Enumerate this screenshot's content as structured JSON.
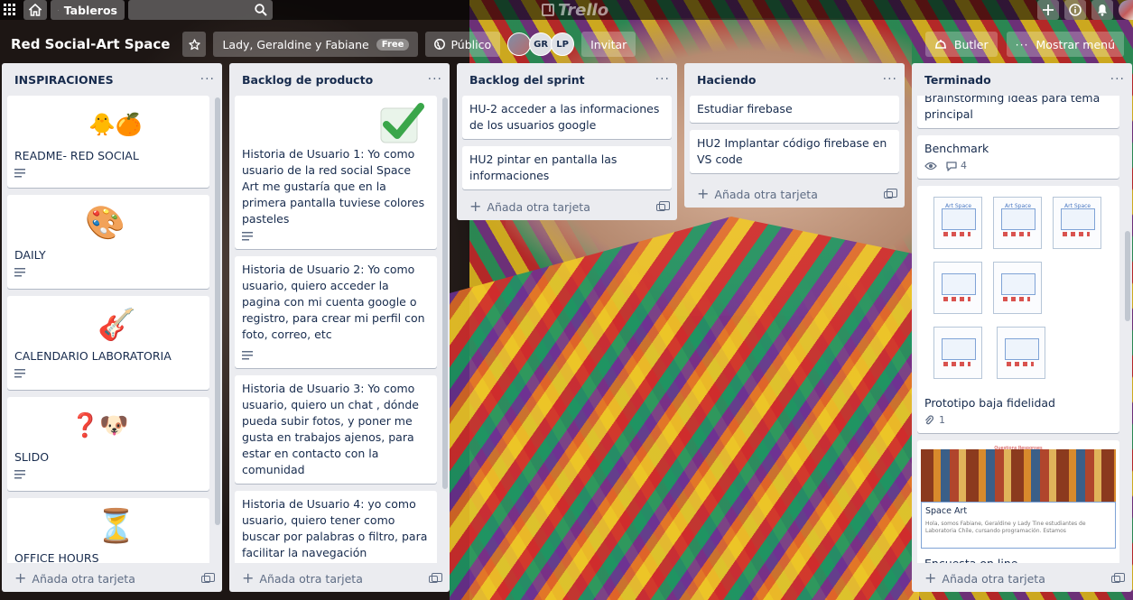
{
  "topbar": {
    "boards_label": "Tableros",
    "logo_text": "Trello"
  },
  "board": {
    "title": "Red Social-Art Space",
    "team_label": "Lady, Geraldine y Fabiane",
    "team_badge": "Free",
    "visibility_label": "Público",
    "members": [
      "GR",
      "LP"
    ],
    "invite_label": "Invitar",
    "butler_label": "Butler",
    "menu_label": "Mostrar menú"
  },
  "add_card_label": "Añada otra tarjeta",
  "lists": [
    {
      "title": "INSPIRACIONES",
      "cards": [
        {
          "title": "README- RED SOCIAL",
          "sticker": "🐥🍊"
        },
        {
          "title": "DAILY",
          "sticker": "🎨"
        },
        {
          "title": "CALENDARIO LABORATORIA",
          "sticker": "🎸"
        },
        {
          "title": "SLIDO",
          "sticker": "❓🐶"
        },
        {
          "title": "OFFICE HOURS",
          "sticker": "⏳"
        }
      ]
    },
    {
      "title": "Backlog de producto",
      "cards": [
        {
          "title": "Historia de Usuario 1: Yo como usuario de la red social Space Art me gustaría que en la primera pantalla tuviese colores pasteles",
          "sticker": "✅"
        },
        {
          "title": "Historia de Usuario 2: Yo como usuario, quiero acceder la pagina con mi cuenta google o registro, para crear mi perfil con foto, correo, etc"
        },
        {
          "title": "Historia de Usuario 3: Yo como usuario, quiero un chat , dónde pueda subir fotos, y poner me gusta en trabajos ajenos, para estar en contacto con la comunidad"
        },
        {
          "title": "Historia de Usuario 4: yo como usuario, quiero tener como buscar por palabras o filtro, para facilitar la navegación"
        }
      ]
    },
    {
      "title": "Backlog del sprint",
      "cards": [
        {
          "title": "HU-2 acceder a las informaciones de los usuarios google"
        },
        {
          "title": "HU2 pintar en pantalla las informaciones"
        }
      ]
    },
    {
      "title": "Haciendo",
      "cards": [
        {
          "title": "Estudiar firebase"
        },
        {
          "title": "HU2 Implantar código firebase en VS code"
        }
      ]
    },
    {
      "title": "Terminado",
      "cards": [
        {
          "title": "Brainstorming ideas para tema principal"
        },
        {
          "title": "Benchmark",
          "comments": "4"
        },
        {
          "title": "Prototipo baja fidelidad",
          "attachments": "1"
        },
        {
          "title": "Encuesta on line"
        }
      ],
      "proto_texts": [
        "Art Space",
        "Art Space",
        "Art Space"
      ],
      "cover_tabs": "Questions    Responses",
      "cover_title": "Space Art",
      "cover_desc": "Hola, somos Fabiane, Geraldine y Lady Tine estudiantes de Laboratoria Chile, cursando programación. Estamos"
    }
  ]
}
